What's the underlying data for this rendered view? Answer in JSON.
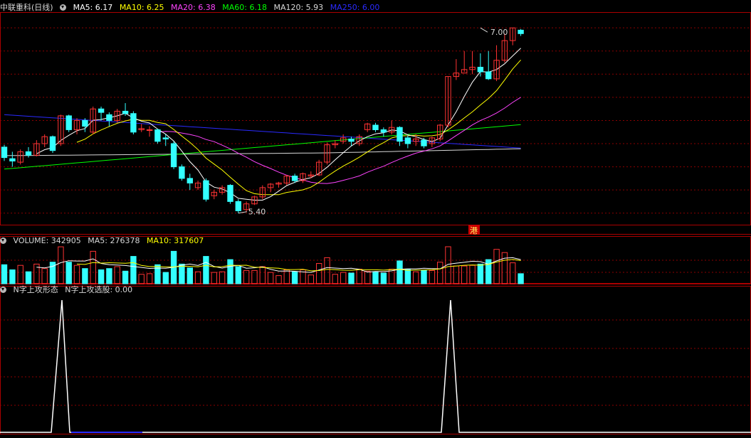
{
  "price_panel": {
    "title": "中联重科(日线)",
    "ma_labels": [
      {
        "text": "MA5: 6.17",
        "color": "#ffffff"
      },
      {
        "text": "MA10: 6.25",
        "color": "#ffff00"
      },
      {
        "text": "MA20: 6.38",
        "color": "#ff44ff"
      },
      {
        "text": "MA60: 6.18",
        "color": "#00ff00"
      },
      {
        "text": "MA120: 5.93",
        "color": "#d8d8d8"
      },
      {
        "text": "MA250: 6.00",
        "color": "#2a2aff"
      }
    ],
    "high_marker": "7.00",
    "low_marker": "5.40",
    "event_marker": "港"
  },
  "volume_panel": {
    "labels": [
      {
        "text": "VOLUME: 342905",
        "color": "#d8d8d8"
      },
      {
        "text": "MA5: 276378",
        "color": "#d8d8d8"
      },
      {
        "text": "MA10: 317607",
        "color": "#ffff00"
      }
    ]
  },
  "indicator_panel": {
    "labels": [
      {
        "text": "N字上攻形态",
        "color": "#d8d8d8"
      },
      {
        "text": "N字上攻选股: 0.00",
        "color": "#d8d8d8"
      }
    ]
  },
  "colors": {
    "up": "#ff3333",
    "down": "#33ffff",
    "grid": "#8b0000",
    "axis": "#aa0000",
    "ma250": "#2a2aff",
    "ma120": "#d8d8d8",
    "ma60": "#00ff00",
    "ma20": "#ff44ff",
    "ma10": "#ffff00",
    "ma5": "#ffffff",
    "signal": "#ffffff"
  },
  "chart_data": {
    "type": "candlestick",
    "title": "中联重科(日线)",
    "y_range": [
      5.3,
      7.13
    ],
    "high": {
      "value": 7.0,
      "index": 59
    },
    "low": {
      "value": 5.4,
      "index": 29
    },
    "candles": [
      [
        5.97,
        5.88,
        5.99,
        5.85
      ],
      [
        5.87,
        5.85,
        5.93,
        5.8
      ],
      [
        5.84,
        5.93,
        5.95,
        5.82
      ],
      [
        5.93,
        5.9,
        5.97,
        5.88
      ],
      [
        5.9,
        6.0,
        6.03,
        5.89
      ],
      [
        6.0,
        6.06,
        6.08,
        5.97
      ],
      [
        6.06,
        5.94,
        6.07,
        5.92
      ],
      [
        6.0,
        6.24,
        6.25,
        5.98
      ],
      [
        6.24,
        6.12,
        6.25,
        6.1
      ],
      [
        6.12,
        6.2,
        6.22,
        6.08
      ],
      [
        6.2,
        6.15,
        6.22,
        6.1
      ],
      [
        6.1,
        6.3,
        6.32,
        6.08
      ],
      [
        6.3,
        6.27,
        6.32,
        6.2
      ],
      [
        6.25,
        6.2,
        6.27,
        6.15
      ],
      [
        6.2,
        6.28,
        6.3,
        6.18
      ],
      [
        6.28,
        6.26,
        6.35,
        6.24
      ],
      [
        6.26,
        6.1,
        6.28,
        6.08
      ],
      [
        6.12,
        6.13,
        6.17,
        6.1
      ],
      [
        6.12,
        6.12,
        6.15,
        6.06
      ],
      [
        6.12,
        6.02,
        6.13,
        6.0
      ],
      [
        6.05,
        6.04,
        6.08,
        5.98
      ],
      [
        6.0,
        5.8,
        6.02,
        5.78
      ],
      [
        5.8,
        5.7,
        5.82,
        5.68
      ],
      [
        5.7,
        5.66,
        5.74,
        5.6
      ],
      [
        5.62,
        5.66,
        5.68,
        5.6
      ],
      [
        5.68,
        5.52,
        5.7,
        5.5
      ],
      [
        5.55,
        5.58,
        5.6,
        5.52
      ],
      [
        5.58,
        5.62,
        5.64,
        5.56
      ],
      [
        5.64,
        5.5,
        5.65,
        5.48
      ],
      [
        5.5,
        5.42,
        5.52,
        5.4
      ],
      [
        5.43,
        5.48,
        5.5,
        5.41
      ],
      [
        5.48,
        5.54,
        5.55,
        5.47
      ],
      [
        5.54,
        5.62,
        5.64,
        5.52
      ],
      [
        5.62,
        5.65,
        5.66,
        5.58
      ],
      [
        5.65,
        5.66,
        5.67,
        5.62
      ],
      [
        5.66,
        5.72,
        5.73,
        5.64
      ],
      [
        5.72,
        5.68,
        5.74,
        5.66
      ],
      [
        5.68,
        5.74,
        5.75,
        5.66
      ],
      [
        5.72,
        5.73,
        5.76,
        5.7
      ],
      [
        5.73,
        5.84,
        5.86,
        5.72
      ],
      [
        5.84,
        5.99,
        6.01,
        5.82
      ],
      [
        5.99,
        6.0,
        6.03,
        5.96
      ],
      [
        6.02,
        6.05,
        6.08,
        6.0
      ],
      [
        6.04,
        6.02,
        6.06,
        5.98
      ],
      [
        6.0,
        6.06,
        6.08,
        5.98
      ],
      [
        6.12,
        6.17,
        6.18,
        6.1
      ],
      [
        6.16,
        6.12,
        6.18,
        6.1
      ],
      [
        6.12,
        6.1,
        6.14,
        6.06
      ],
      [
        6.1,
        6.14,
        6.2,
        6.08
      ],
      [
        6.14,
        6.02,
        6.15,
        5.98
      ],
      [
        6.05,
        6.0,
        6.07,
        5.96
      ],
      [
        6.02,
        6.04,
        6.08,
        5.98
      ],
      [
        6.03,
        5.98,
        6.05,
        5.96
      ],
      [
        6.0,
        6.05,
        6.06,
        5.97
      ],
      [
        6.04,
        6.16,
        6.17,
        6.02
      ],
      [
        6.16,
        6.58,
        6.58,
        6.14
      ],
      [
        6.58,
        6.61,
        6.73,
        6.55
      ],
      [
        6.61,
        6.64,
        6.8,
        6.62
      ],
      [
        6.64,
        6.66,
        6.8,
        6.6
      ],
      [
        6.66,
        6.62,
        6.78,
        6.58
      ],
      [
        6.62,
        6.56,
        6.8,
        6.55
      ],
      [
        6.56,
        6.72,
        6.85,
        6.54
      ],
      [
        6.72,
        6.89,
        6.95,
        6.7
      ],
      [
        6.89,
        7.0,
        7.0,
        6.85
      ],
      [
        6.98,
        6.95,
        6.99,
        6.93
      ]
    ]
  }
}
